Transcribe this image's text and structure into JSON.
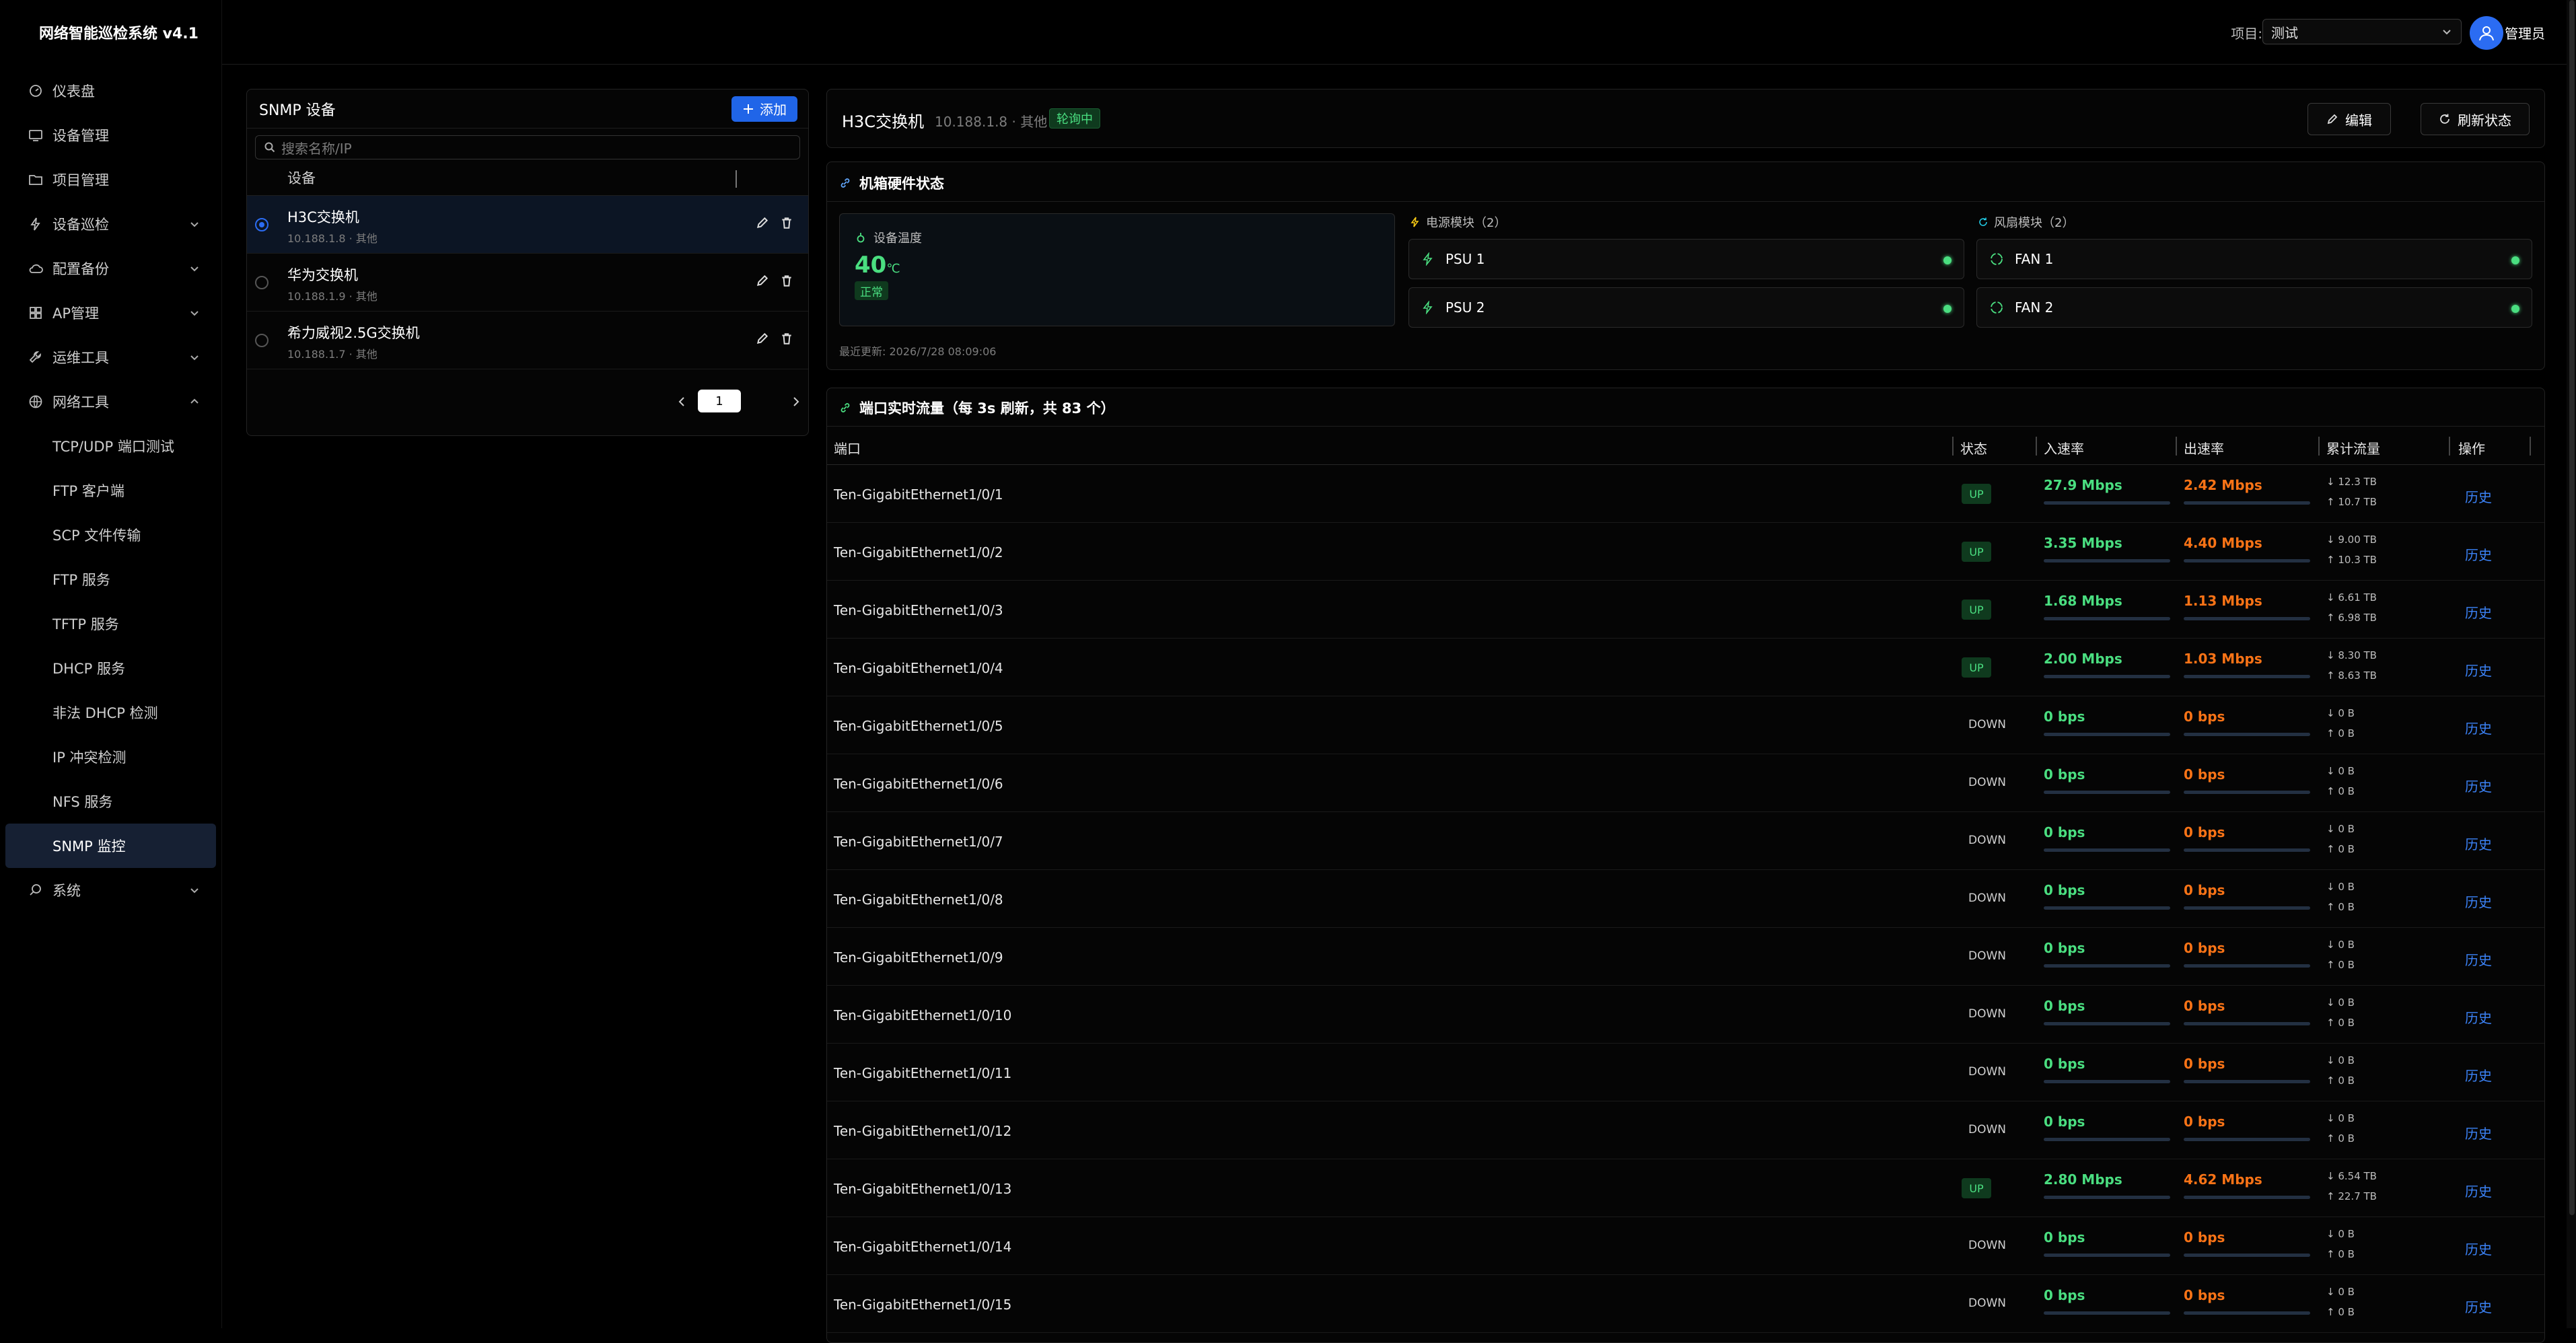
{
  "app": {
    "title": "网络智能巡检系统 v4.1"
  },
  "sidebar": {
    "items": [
      {
        "label": "仪表盘",
        "icon": "dashboard-icon"
      },
      {
        "label": "设备管理",
        "icon": "monitor-icon"
      },
      {
        "label": "项目管理",
        "icon": "folder-icon"
      },
      {
        "label": "设备巡检",
        "icon": "lightning-icon",
        "expandable": true
      },
      {
        "label": "配置备份",
        "icon": "cloud-icon",
        "expandable": true
      },
      {
        "label": "AP管理",
        "icon": "grid-icon",
        "expandable": true
      },
      {
        "label": "运维工具",
        "icon": "wrench-icon",
        "expandable": true
      },
      {
        "label": "网络工具",
        "icon": "globe-icon",
        "expanded": true
      }
    ],
    "sub_items": [
      "TCP/UDP 端口测试",
      "FTP 客户端",
      "SCP 文件传输",
      "FTP 服务",
      "TFTP 服务",
      "DHCP 服务",
      "非法 DHCP 检测",
      "IP 冲突检测",
      "NFS 服务",
      "SNMP 监控"
    ],
    "active_sub": "SNMP 监控",
    "bottom_item": {
      "label": "系统",
      "icon": "search-icon"
    }
  },
  "header": {
    "project_label": "项目:",
    "project_value": "测试",
    "user_name": "管理员"
  },
  "devices": {
    "title": "SNMP 设备",
    "add_label": "添加",
    "search_placeholder": "搜索名称/IP",
    "column": "设备",
    "rows": [
      {
        "name": "H3C交换机",
        "sub": "10.188.1.8 · 其他",
        "selected": true
      },
      {
        "name": "华为交换机",
        "sub": "10.188.1.9 · 其他",
        "selected": false
      },
      {
        "name": "希力威视2.5G交换机",
        "sub": "10.188.1.7 · 其他",
        "selected": false
      }
    ],
    "page": "1"
  },
  "detail": {
    "title": "H3C交换机",
    "ip": "10.188.1.8 · 其他",
    "badge": "轮询中",
    "edit_label": "编辑",
    "refresh_label": "刷新状态"
  },
  "hardware": {
    "title": "机箱硬件状态",
    "temp_label": "设备温度",
    "temp_value": "40",
    "temp_unit": "℃",
    "temp_status": "正常",
    "psu_label": "电源模块（2）",
    "fan_label": "风扇模块（2）",
    "psus": [
      "PSU 1",
      "PSU 2"
    ],
    "fans": [
      "FAN 1",
      "FAN 2"
    ],
    "updated": "最近更新: 2026/7/28 08:09:06",
    "status_color": "#4ade80"
  },
  "ports": {
    "title": "端口实时流量（每 3s 刷新，共 83 个）",
    "columns": {
      "port": "端口",
      "status": "状态",
      "in": "入速率",
      "out": "出速率",
      "total": "累计流量",
      "action": "操作"
    },
    "rows": [
      {
        "port": "Ten-GigabitEthernet1/0/1",
        "status": "UP",
        "in": "27.9 Mbps",
        "out": "2.42 Mbps",
        "down": "↓ 12.3 TB",
        "up": "↑ 10.7 TB",
        "action": "历史"
      },
      {
        "port": "Ten-GigabitEthernet1/0/2",
        "status": "UP",
        "in": "3.35 Mbps",
        "out": "4.40 Mbps",
        "down": "↓ 9.00 TB",
        "up": "↑ 10.3 TB",
        "action": "历史"
      },
      {
        "port": "Ten-GigabitEthernet1/0/3",
        "status": "UP",
        "in": "1.68 Mbps",
        "out": "1.13 Mbps",
        "down": "↓ 6.61 TB",
        "up": "↑ 6.98 TB",
        "action": "历史"
      },
      {
        "port": "Ten-GigabitEthernet1/0/4",
        "status": "UP",
        "in": "2.00 Mbps",
        "out": "1.03 Mbps",
        "down": "↓ 8.30 TB",
        "up": "↑ 8.63 TB",
        "action": "历史"
      },
      {
        "port": "Ten-GigabitEthernet1/0/5",
        "status": "DOWN",
        "in": "0 bps",
        "out": "0 bps",
        "down": "↓ 0 B",
        "up": "↑ 0 B",
        "action": "历史"
      },
      {
        "port": "Ten-GigabitEthernet1/0/6",
        "status": "DOWN",
        "in": "0 bps",
        "out": "0 bps",
        "down": "↓ 0 B",
        "up": "↑ 0 B",
        "action": "历史"
      },
      {
        "port": "Ten-GigabitEthernet1/0/7",
        "status": "DOWN",
        "in": "0 bps",
        "out": "0 bps",
        "down": "↓ 0 B",
        "up": "↑ 0 B",
        "action": "历史"
      },
      {
        "port": "Ten-GigabitEthernet1/0/8",
        "status": "DOWN",
        "in": "0 bps",
        "out": "0 bps",
        "down": "↓ 0 B",
        "up": "↑ 0 B",
        "action": "历史"
      },
      {
        "port": "Ten-GigabitEthernet1/0/9",
        "status": "DOWN",
        "in": "0 bps",
        "out": "0 bps",
        "down": "↓ 0 B",
        "up": "↑ 0 B",
        "action": "历史"
      },
      {
        "port": "Ten-GigabitEthernet1/0/10",
        "status": "DOWN",
        "in": "0 bps",
        "out": "0 bps",
        "down": "↓ 0 B",
        "up": "↑ 0 B",
        "action": "历史"
      },
      {
        "port": "Ten-GigabitEthernet1/0/11",
        "status": "DOWN",
        "in": "0 bps",
        "out": "0 bps",
        "down": "↓ 0 B",
        "up": "↑ 0 B",
        "action": "历史"
      },
      {
        "port": "Ten-GigabitEthernet1/0/12",
        "status": "DOWN",
        "in": "0 bps",
        "out": "0 bps",
        "down": "↓ 0 B",
        "up": "↑ 0 B",
        "action": "历史"
      },
      {
        "port": "Ten-GigabitEthernet1/0/13",
        "status": "UP",
        "in": "2.80 Mbps",
        "out": "4.62 Mbps",
        "down": "↓ 6.54 TB",
        "up": "↑ 22.7 TB",
        "action": "历史"
      },
      {
        "port": "Ten-GigabitEthernet1/0/14",
        "status": "DOWN",
        "in": "0 bps",
        "out": "0 bps",
        "down": "↓ 0 B",
        "up": "↑ 0 B",
        "action": "历史"
      },
      {
        "port": "Ten-GigabitEthernet1/0/15",
        "status": "DOWN",
        "in": "0 bps",
        "out": "0 bps",
        "down": "↓ 0 B",
        "up": "↑ 0 B",
        "action": "历史"
      }
    ]
  },
  "colors": {
    "accent": "#2065e8",
    "up": "#4ade80",
    "out": "#f97316",
    "link": "#3b82f6"
  }
}
